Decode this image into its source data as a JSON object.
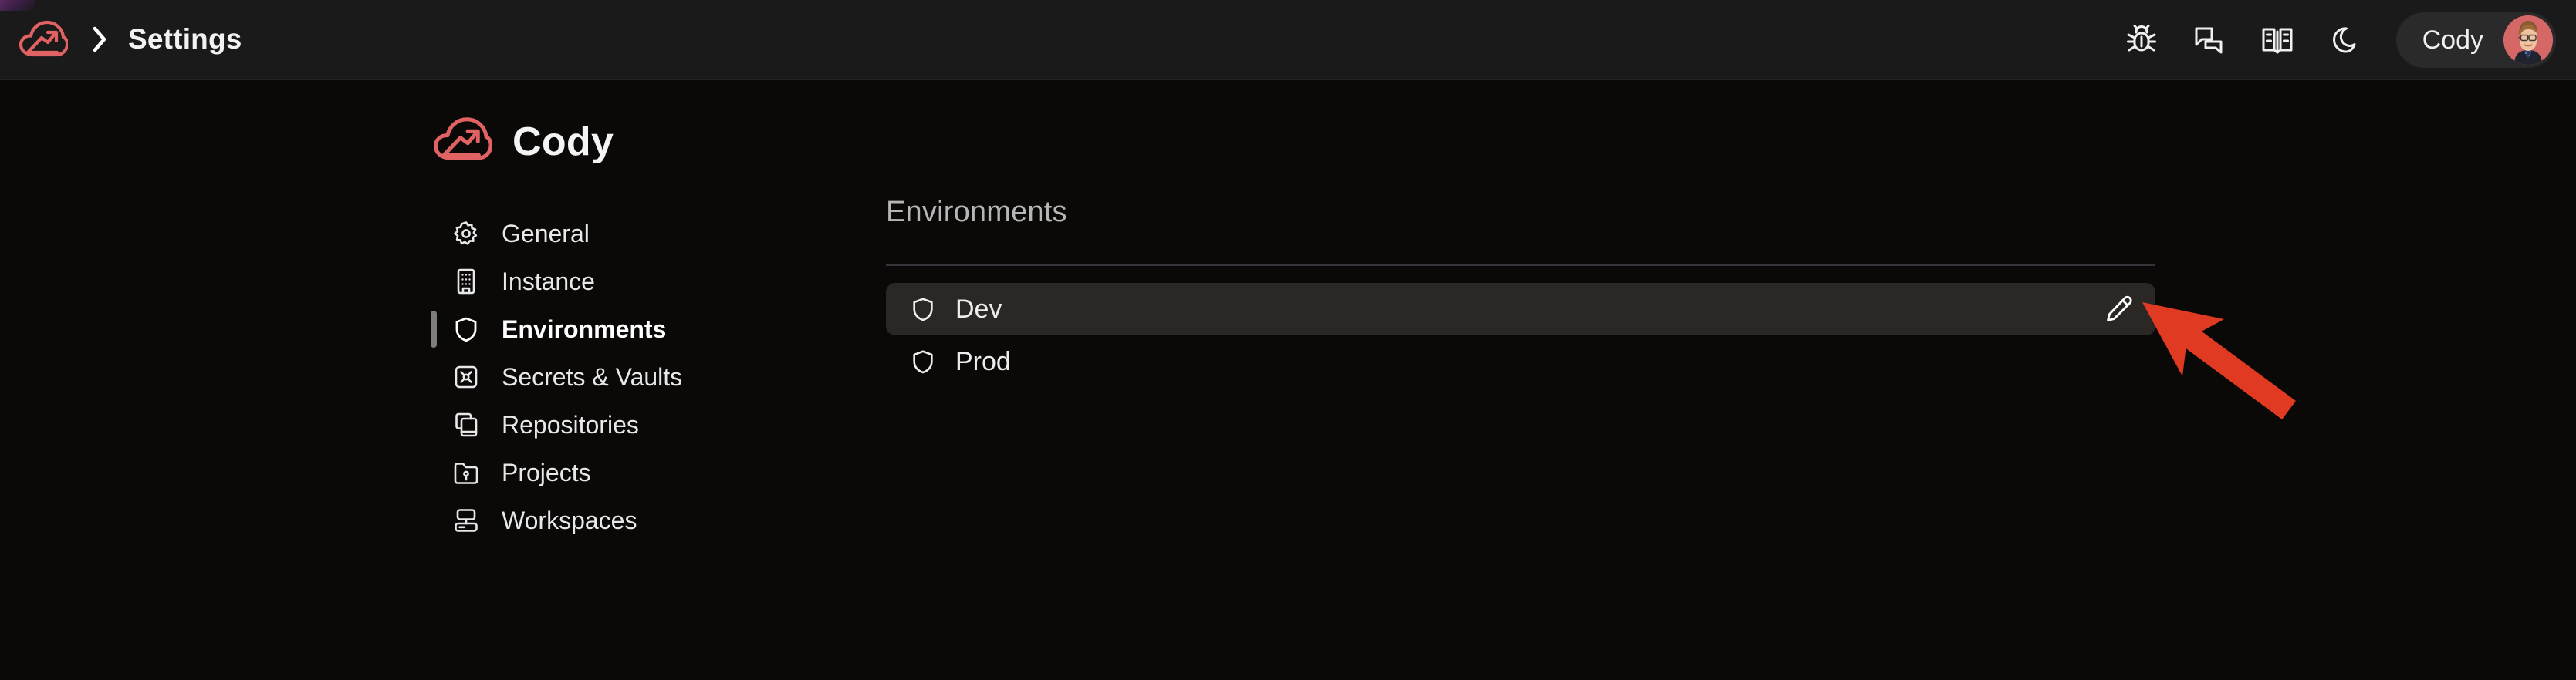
{
  "colors": {
    "page_bg": "#0a0908",
    "header_bg": "#1a1a1a",
    "brand_red": "#e06262",
    "selected_row_bg": "#2b2725",
    "accent_arrow": "#e03a22",
    "active_marker": "#7d7d7d",
    "section_heading": "#b6b6b6",
    "divider": "#35353a"
  },
  "header": {
    "logo_icon": "cloud-arrow-logo-icon",
    "separator_icon": "chevron-right-icon",
    "breadcrumb_label": "Settings",
    "actions": [
      {
        "icon": "bug-icon",
        "name": "debug-button"
      },
      {
        "icon": "chat-bubbles-icon",
        "name": "feedback-button"
      },
      {
        "icon": "book-icon",
        "name": "docs-button"
      },
      {
        "icon": "moon-icon",
        "name": "theme-toggle-button"
      }
    ],
    "user": {
      "name": "Cody",
      "avatar_icon": "user-avatar"
    }
  },
  "page": {
    "title": "Cody",
    "title_icon": "cloud-arrow-logo-icon"
  },
  "sidebar": {
    "items": [
      {
        "label": "General",
        "icon": "gear-icon",
        "active": false
      },
      {
        "label": "Instance",
        "icon": "building-icon",
        "active": false
      },
      {
        "label": "Environments",
        "icon": "shield-icon",
        "active": true
      },
      {
        "label": "Secrets & Vaults",
        "icon": "key-box-icon",
        "active": false
      },
      {
        "label": "Repositories",
        "icon": "copy-icon",
        "active": false
      },
      {
        "label": "Projects",
        "icon": "folder-key-icon",
        "active": false
      },
      {
        "label": "Workspaces",
        "icon": "server-icon",
        "active": false
      }
    ]
  },
  "main": {
    "section_title": "Environments",
    "rows": [
      {
        "label": "Dev",
        "icon": "shield-icon",
        "selected": true,
        "edit_icon": "pencil-icon"
      },
      {
        "label": "Prod",
        "icon": "shield-icon",
        "selected": false,
        "edit_icon": ""
      }
    ]
  },
  "annotation": {
    "type": "arrow",
    "points_at": "edit-environment-button",
    "color": "#e03a22"
  }
}
